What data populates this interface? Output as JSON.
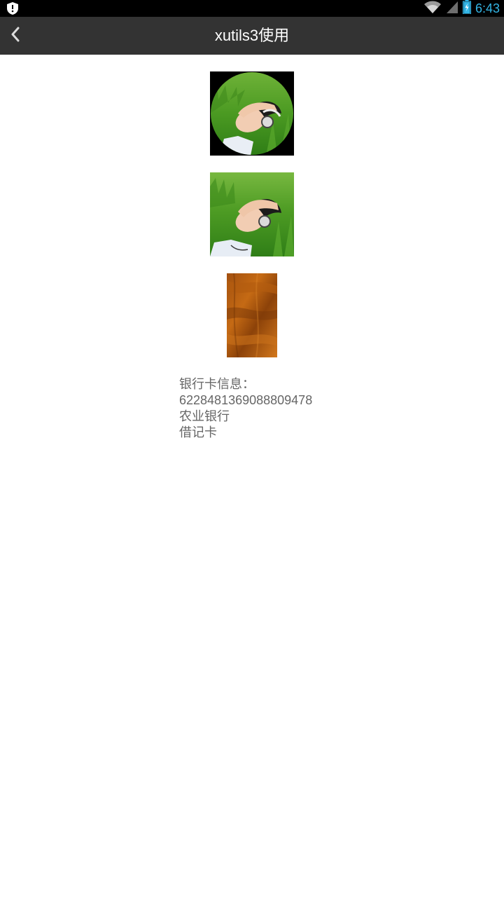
{
  "status_bar": {
    "time": "6:43",
    "icons": [
      "shield-notification-icon",
      "wifi-icon",
      "signal-icon",
      "battery-charging-icon"
    ],
    "time_color": "#33b5e5"
  },
  "action_bar": {
    "title": "xutils3使用",
    "back_icon": "back-arrow-icon",
    "background": "#333333"
  },
  "images": [
    {
      "name": "circular-photo",
      "shape": "circle"
    },
    {
      "name": "square-photo",
      "shape": "square"
    },
    {
      "name": "fur-texture-image",
      "shape": "rectangle"
    }
  ],
  "card_info": {
    "label": "银行卡信息：",
    "card_number": "6228481369088809478",
    "bank_name": "农业银行",
    "card_type": "借记卡"
  }
}
